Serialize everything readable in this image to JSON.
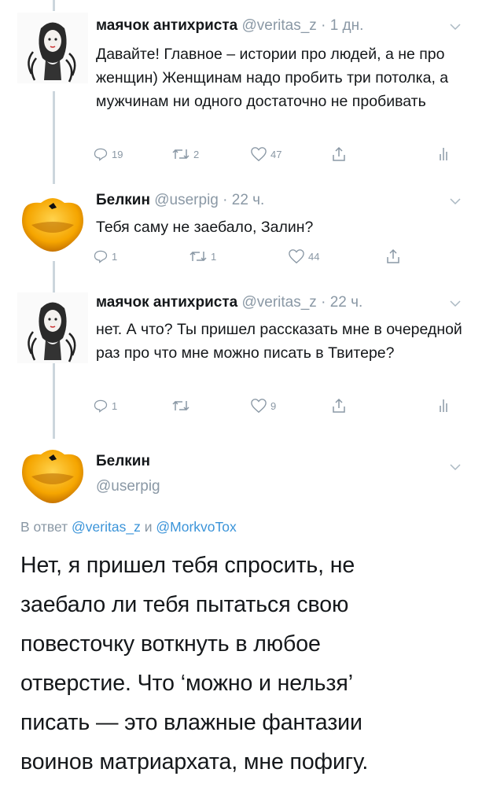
{
  "tweets": [
    {
      "display_name": "маячок антихриста",
      "handle": "@veritas_z",
      "time": "· 1 дн.",
      "text": "Давайте! Главное – истории про людей, а не про женщин) Женщинам надо пробить три потолка, а мужчинам ни одного достаточно не пробивать",
      "replies": "19",
      "retweets": "2",
      "likes": "47"
    },
    {
      "display_name": "Белкин",
      "handle": "@userpig",
      "time": "· 22 ч.",
      "text": "Тебя саму не заебало, Залин?",
      "replies": "1",
      "retweets": "1",
      "likes": "44"
    },
    {
      "display_name": "маячок антихриста",
      "handle": "@veritas_z",
      "time": "· 22 ч.",
      "text": "нет. А что? Ты пришел рассказать мне в очередной раз про что мне можно писать в Твитере?",
      "replies": "1",
      "retweets": "",
      "likes": "9"
    }
  ],
  "focus": {
    "display_name": "Белкин",
    "handle": "@userpig",
    "reply_prefix": "В ответ",
    "reply_user1": "@veritas_z",
    "reply_and": "и",
    "reply_user2": "@MorkvoTox",
    "lines": [
      "Нет, я пришел тебя спросить, не",
      "заебало ли тебя пытаться свою",
      "повесточку воткнуть в любое",
      "отверстие. Что ‘можно и нельзя’",
      "писать — это влажные фантазии",
      "воинов матриархата, мне пофигу."
    ]
  },
  "icons": {
    "chevron": "chevron-down-icon",
    "reply": "reply-icon",
    "retweet": "retweet-icon",
    "like": "heart-icon",
    "share": "share-icon",
    "analytics": "analytics-icon"
  },
  "colors": {
    "text": "#14171a",
    "meta": "#8a98a5",
    "link": "#3b94d9",
    "thread_line": "#ccd6dd"
  }
}
